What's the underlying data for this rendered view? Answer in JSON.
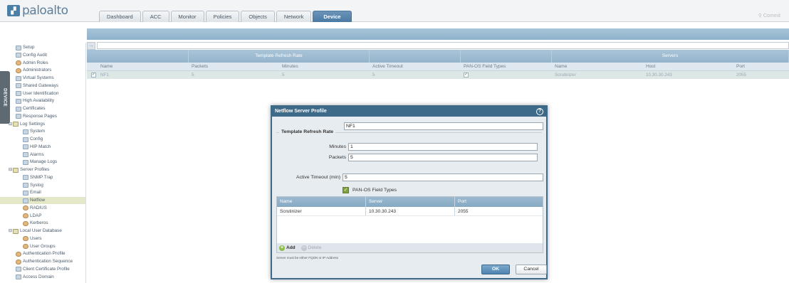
{
  "brand": {
    "name": "paloalto",
    "sub": "NETWORKS"
  },
  "tabs": [
    {
      "label": "Dashboard"
    },
    {
      "label": "ACC"
    },
    {
      "label": "Monitor"
    },
    {
      "label": "Policies"
    },
    {
      "label": "Objects"
    },
    {
      "label": "Network"
    },
    {
      "label": "Device",
      "active": true
    }
  ],
  "commit_label": "Commit",
  "side_tab": "DEVICE",
  "sidebar": {
    "items": [
      {
        "label": "Setup",
        "icon": "gear-icon"
      },
      {
        "label": "Config Audit",
        "icon": "audit-icon"
      },
      {
        "label": "Admin Roles",
        "icon": "person-icon"
      },
      {
        "label": "Administrators",
        "icon": "person-icon"
      },
      {
        "label": "Virtual Systems",
        "icon": "system-icon"
      },
      {
        "label": "Shared Gateways",
        "icon": "gateway-icon"
      },
      {
        "label": "User Identification",
        "icon": "user-id-icon"
      },
      {
        "label": "High Availability",
        "icon": "ha-icon"
      },
      {
        "label": "Certificates",
        "icon": "certificate-icon"
      },
      {
        "label": "Response Pages",
        "icon": "page-icon"
      },
      {
        "label": "Log Settings",
        "icon": "folder-icon"
      },
      {
        "label": "System",
        "icon": "log-icon"
      },
      {
        "label": "Config",
        "icon": "log-icon"
      },
      {
        "label": "HIP Match",
        "icon": "log-icon"
      },
      {
        "label": "Alarms",
        "icon": "log-icon"
      },
      {
        "label": "Manage Logs",
        "icon": "log-icon"
      },
      {
        "label": "Server Profiles",
        "icon": "folder-icon"
      },
      {
        "label": "SNMP Trap",
        "icon": "server-icon"
      },
      {
        "label": "Syslog",
        "icon": "server-icon"
      },
      {
        "label": "Email",
        "icon": "server-icon"
      },
      {
        "label": "Netflow",
        "icon": "server-icon",
        "selected": true
      },
      {
        "label": "RADIUS",
        "icon": "person-icon"
      },
      {
        "label": "LDAP",
        "icon": "person-icon"
      },
      {
        "label": "Kerberos",
        "icon": "person-icon"
      },
      {
        "label": "Local User Database",
        "icon": "folder-icon"
      },
      {
        "label": "Users",
        "icon": "person-icon"
      },
      {
        "label": "User Groups",
        "icon": "person-icon"
      },
      {
        "label": "Authentication Profile",
        "icon": "person-icon"
      },
      {
        "label": "Authentication Sequence",
        "icon": "person-icon"
      },
      {
        "label": "Client Certificate Profile",
        "icon": "certificate-icon"
      },
      {
        "label": "Access Domain",
        "icon": "domain-icon"
      }
    ]
  },
  "table": {
    "groups": {
      "template": "Template Refresh Rate",
      "servers": "Servers"
    },
    "columns": [
      "Name",
      "Packets",
      "Minutes",
      "Active Timeout",
      "PAN-OS Field Types",
      "Name",
      "Host",
      "Port"
    ],
    "rows": [
      {
        "name": "NF1",
        "packets": "5",
        "minutes": "5",
        "active_timeout": "5",
        "srv_name": "Scrutinizer",
        "host": "10.30.30.243",
        "port": "2055"
      }
    ]
  },
  "dialog": {
    "title": "Netflow Server Profile",
    "name_label": "Name",
    "name_value": "NF1",
    "section_title": "Template Refresh Rate",
    "minutes_label": "Minutes",
    "minutes_value": "1",
    "packets_label": "Packets",
    "packets_value": "5",
    "timeout_label": "Active Timeout (min)",
    "timeout_value": "5",
    "panos_label": "PAN-OS Field Types",
    "server_columns": [
      "Name",
      "Server",
      "Port"
    ],
    "servers": [
      {
        "name": "Scrutinizer",
        "server": "10.30.30.243",
        "port": "2055"
      }
    ],
    "add_label": "Add",
    "delete_label": "Delete",
    "note": "Server must be either FQDN or IP Address",
    "ok_label": "OK",
    "cancel_label": "Cancel"
  }
}
